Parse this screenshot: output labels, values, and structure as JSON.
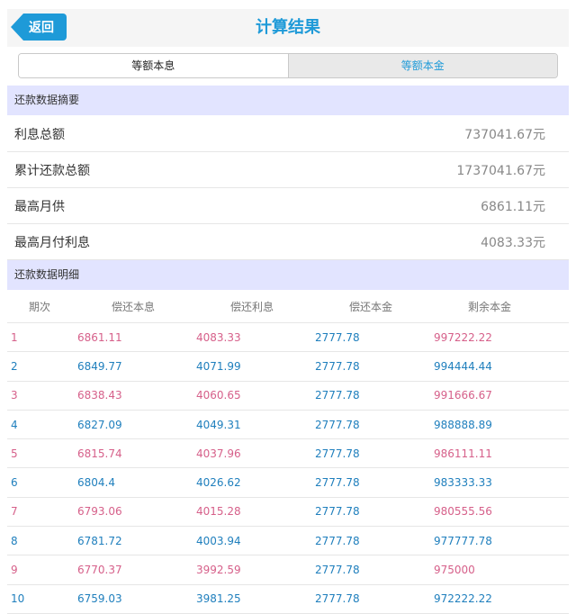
{
  "header": {
    "back_label": "返回",
    "title": "计算结果"
  },
  "tabs": [
    {
      "label": "等额本息",
      "active": true
    },
    {
      "label": "等额本金",
      "active": false
    }
  ],
  "summary": {
    "section_title": "还款数据摘要",
    "rows": [
      {
        "label": "利息总额",
        "value": "737041.67元"
      },
      {
        "label": "累计还款总额",
        "value": "1737041.67元"
      },
      {
        "label": "最高月供",
        "value": "6861.11元"
      },
      {
        "label": "最高月付利息",
        "value": "4083.33元"
      }
    ]
  },
  "detail": {
    "section_title": "还款数据明细",
    "columns": [
      "期次",
      "偿还本息",
      "偿还利息",
      "偿还本金",
      "剩余本金"
    ],
    "rows": [
      [
        "1",
        "6861.11",
        "4083.33",
        "2777.78",
        "997222.22"
      ],
      [
        "2",
        "6849.77",
        "4071.99",
        "2777.78",
        "994444.44"
      ],
      [
        "3",
        "6838.43",
        "4060.65",
        "2777.78",
        "991666.67"
      ],
      [
        "4",
        "6827.09",
        "4049.31",
        "2777.78",
        "988888.89"
      ],
      [
        "5",
        "6815.74",
        "4037.96",
        "2777.78",
        "986111.11"
      ],
      [
        "6",
        "6804.4",
        "4026.62",
        "2777.78",
        "983333.33"
      ],
      [
        "7",
        "6793.06",
        "4015.28",
        "2777.78",
        "980555.56"
      ],
      [
        "8",
        "6781.72",
        "4003.94",
        "2777.78",
        "977777.78"
      ],
      [
        "9",
        "6770.37",
        "3992.59",
        "2777.78",
        "975000"
      ],
      [
        "10",
        "6759.03",
        "3981.25",
        "2777.78",
        "972222.22"
      ]
    ]
  },
  "colors": {
    "accent": "#1e9ad8",
    "odd_row": "#d6608a",
    "even_row": "#1f7fbd",
    "section_bg": "#e2e4ff"
  }
}
